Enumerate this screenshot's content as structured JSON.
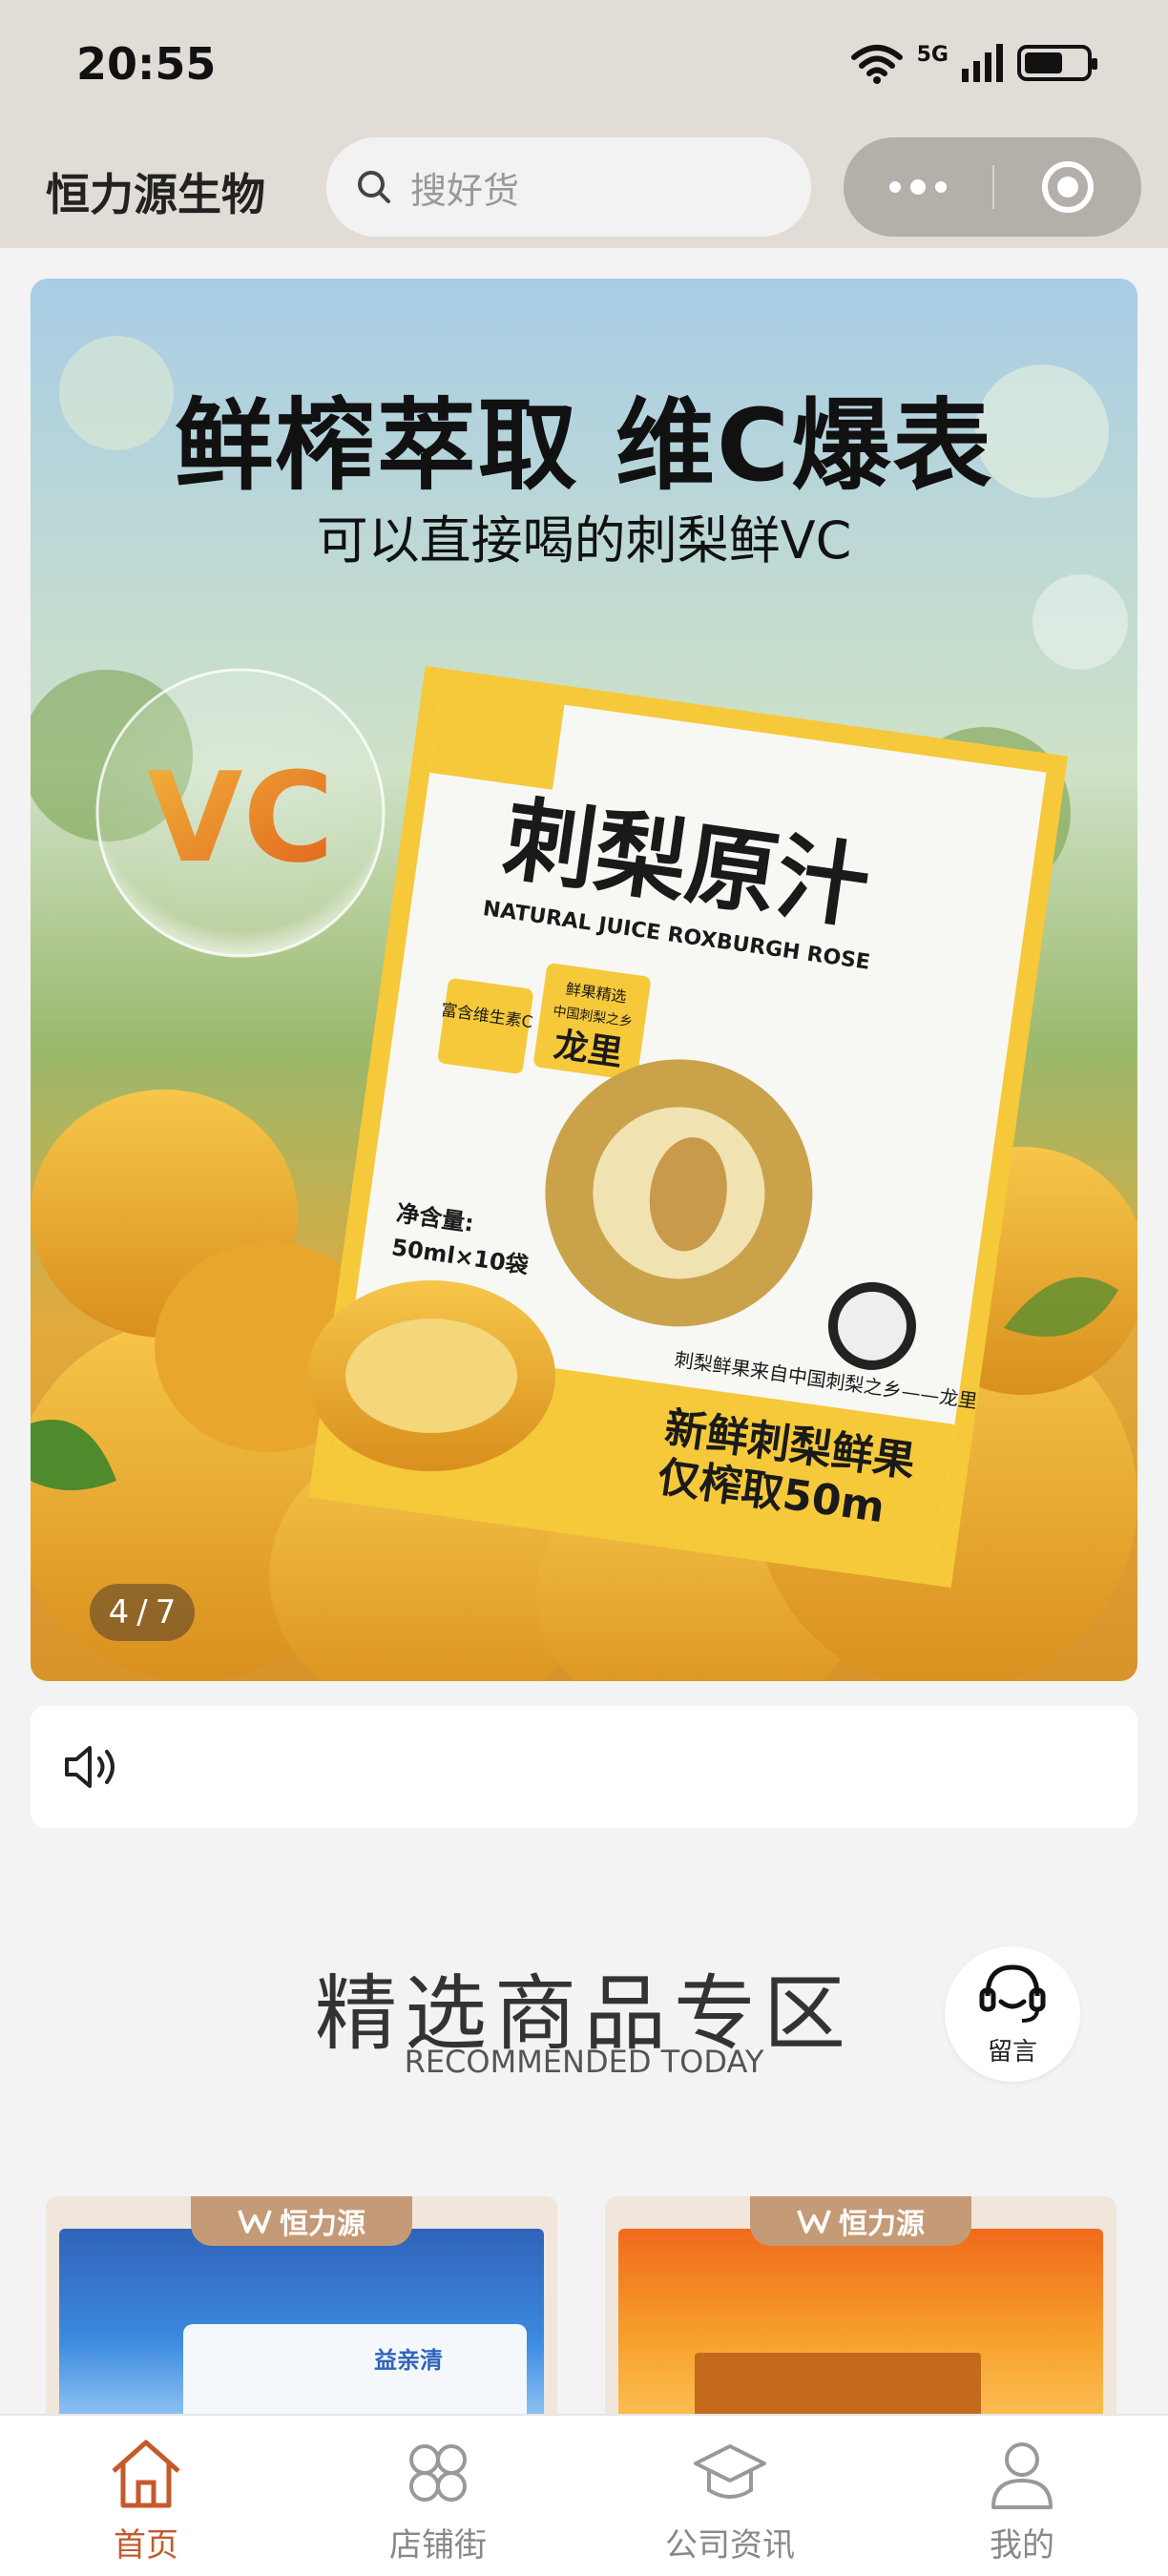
{
  "status_bar": {
    "time": "20:55",
    "network": "5G"
  },
  "nav": {
    "app_name": "恒力源生物",
    "search_placeholder": "搜好货"
  },
  "banner": {
    "title": "鲜榨萃取 维C爆表",
    "subtitle": "可以直接喝的刺梨鲜VC",
    "product_name": "刺梨原汁",
    "product_name_en": "NATURAL JUICE ROXBURGH ROSE",
    "vc_text": "VC",
    "badge_1": "富含维生素C",
    "badge_2_line1": "鲜果精选",
    "badge_2_line2": "中国刺梨之乡",
    "badge_2_main": "龙里",
    "net_content_label": "净含量:",
    "net_content_value": "50ml×10袋",
    "origin_text": "刺梨鲜果来自中国刺梨之乡——龙里",
    "slogan_line1": "新鲜刺梨鲜果",
    "slogan_line2": "仅榨取50m",
    "page_current": "4",
    "page_sep": "/",
    "page_total": "7"
  },
  "notice": {
    "icon": "speaker-icon"
  },
  "section": {
    "title": "精选商品专区",
    "subtitle": "RECOMMENDED TODAY",
    "message_label": "留言"
  },
  "products": [
    {
      "brand": "恒力源",
      "pack_label": "益亲清"
    },
    {
      "brand": "恒力源"
    }
  ],
  "tab_bar": {
    "items": [
      {
        "label": "首页",
        "icon": "home-icon",
        "active": true
      },
      {
        "label": "店铺街",
        "icon": "grid-icon",
        "active": false
      },
      {
        "label": "公司资讯",
        "icon": "graduation-cap-icon",
        "active": false
      },
      {
        "label": "我的",
        "icon": "user-icon",
        "active": false
      }
    ]
  },
  "colors": {
    "status_bg": "#e2dcd6",
    "active_tab": "#c45a2c",
    "card_tab": "#c59a76"
  }
}
